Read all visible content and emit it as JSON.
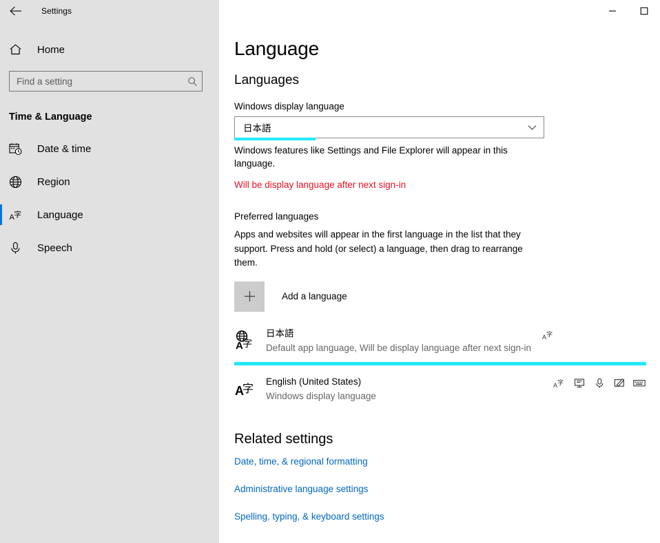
{
  "window": {
    "app_title": "Settings",
    "back_icon": "back-arrow-icon",
    "controls": [
      {
        "name": "minimize-button",
        "glyph": "minimize-icon"
      },
      {
        "name": "maximize-button",
        "glyph": "maximize-icon"
      }
    ]
  },
  "sidebar": {
    "home_label": "Home",
    "home_icon": "home-icon",
    "search": {
      "placeholder": "Find a setting",
      "value": "",
      "icon": "search-icon"
    },
    "category": "Time & Language",
    "items": [
      {
        "label": "Date & time",
        "icon": "calendar-clock-icon",
        "selected": false
      },
      {
        "label": "Region",
        "icon": "globe-icon",
        "selected": false
      },
      {
        "label": "Language",
        "icon": "language-icon",
        "selected": true
      },
      {
        "label": "Speech",
        "icon": "microphone-icon",
        "selected": false
      }
    ]
  },
  "main": {
    "page_title": "Language",
    "languages_heading": "Languages",
    "display_language": {
      "label": "Windows display language",
      "value": "日本語",
      "arrow_icon": "chevron-down-icon",
      "description": "Windows features like Settings and File Explorer will appear in this language.",
      "warning": "Will be display language after next sign-in",
      "warning_color": "#e81123",
      "highlight_color": "#22e8ff"
    },
    "preferred": {
      "title": "Preferred languages",
      "description": "Apps and websites will appear in the first language in the list that they support. Press and hold (or select) a language, then drag to rearrange them.",
      "add_label": "Add a language",
      "add_icon": "plus-icon",
      "list": [
        {
          "name": "日本語",
          "sub": "Default app language, Will be display language after next sign-in",
          "icon": "globe-language-pack-icon",
          "highlighted": true,
          "highlight_color": "#22e8ff",
          "actions": [
            {
              "name": "language-pack-icon"
            }
          ]
        },
        {
          "name": "English (United States)",
          "sub": "Windows display language",
          "icon": "language-pack-icon",
          "highlighted": false,
          "actions": [
            {
              "name": "language-pack-icon"
            },
            {
              "name": "display-monitor-icon"
            },
            {
              "name": "microphone-icon"
            },
            {
              "name": "handwriting-pen-icon"
            },
            {
              "name": "keyboard-icon"
            }
          ]
        }
      ]
    },
    "related": {
      "title": "Related settings",
      "link_color": "#0067c0",
      "links": [
        {
          "label": "Date, time, & regional formatting"
        },
        {
          "label": "Administrative language settings"
        },
        {
          "label": "Spelling, typing, & keyboard settings"
        }
      ]
    }
  }
}
